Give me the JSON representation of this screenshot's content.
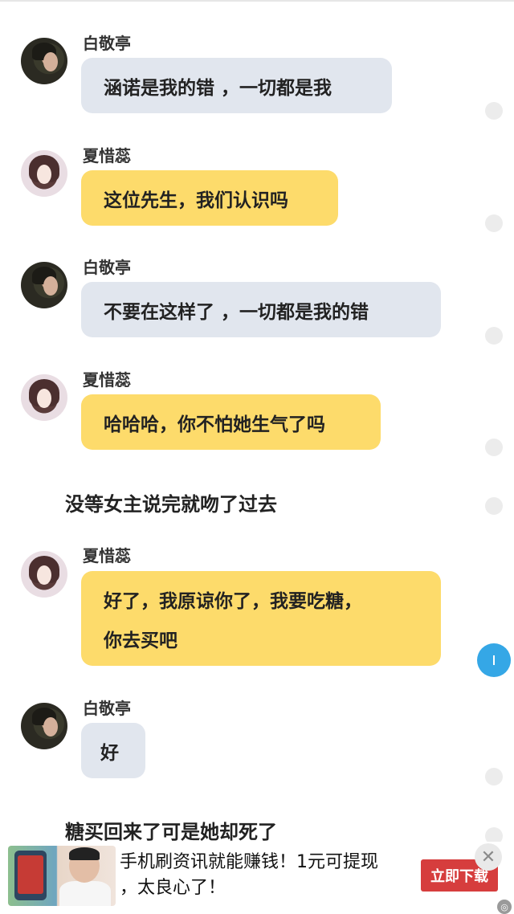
{
  "messages": [
    {
      "speaker": "白敬亭",
      "text": "涵诺是我的错 ，一切都是我"
    },
    {
      "speaker": "夏惜蕊",
      "text": "这位先生，我们认识吗"
    },
    {
      "speaker": "白敬亭",
      "text": "不要在这样了 ，一切都是我的错"
    },
    {
      "speaker": "夏惜蕊",
      "text": "哈哈哈，你不怕她生气了吗"
    },
    {
      "narration": "没等女主说完就吻了过去"
    },
    {
      "speaker": "夏惜蕊",
      "line1": "好了，我原谅你了，我要吃糖，",
      "line2": "你去买吧"
    },
    {
      "speaker": "白敬亭",
      "text": "好"
    },
    {
      "narration": "糖买回来了可是她却死了"
    }
  ],
  "ad": {
    "text_line1": "手机刷资讯就能赚钱！1元可提现",
    "text_line2": "，太良心了！",
    "button_label": "立即下载",
    "close_symbol": "✕",
    "badge_symbol": "◎"
  },
  "colors": {
    "male_bubble": "#e1e6ee",
    "female_bubble": "#fddb6b",
    "fab": "#35a7e6",
    "ad_button": "#d63d3d"
  },
  "icons": {
    "fab": "info-icon",
    "side_markers": "circle-dot-icon"
  }
}
